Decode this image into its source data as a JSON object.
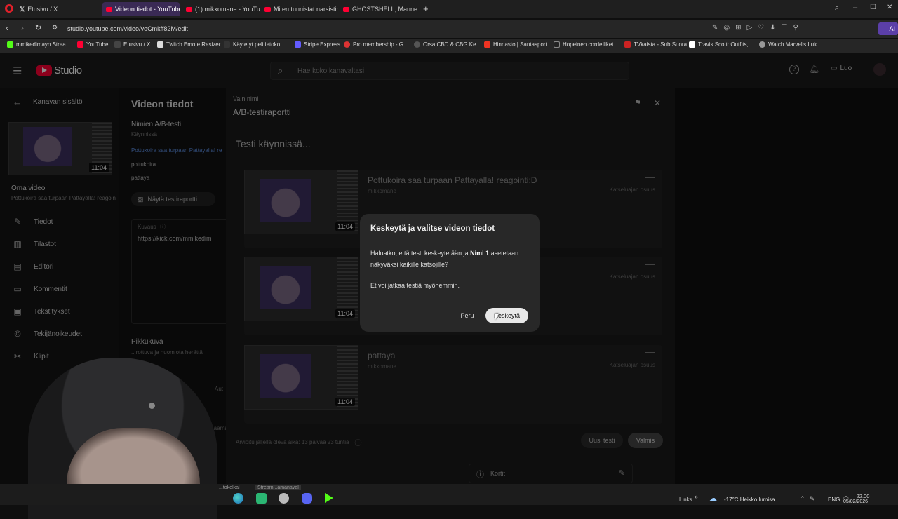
{
  "browser": {
    "tabs": [
      {
        "label": "Etusivu / X",
        "icon": "x-logo-icon"
      },
      {
        "label": "Videon tiedot - YouTube",
        "icon": "youtube-icon"
      },
      {
        "label": "(1) mikkomane - YouTube",
        "icon": "youtube-icon"
      },
      {
        "label": "Miten tunnistat narsistin?",
        "icon": "youtube-icon"
      },
      {
        "label": "GHOSTSHELL, Mannequin",
        "icon": "youtube-icon"
      }
    ],
    "url": "studio.youtube.com/video/voCmkff82M/edit",
    "bookmarks": [
      "mmikedimayn Strea...",
      "YouTube",
      "Etusivu / X",
      "Twitch Emote Resizer",
      "Käytetyt pelitietoko...",
      "Stripe Express",
      "Pro membership - G...",
      "Orsa CBD & CBG Ke...",
      "Hinnasto | Santasport",
      "Hopeinen cordelliket...",
      "TVkaista - Sub Suora",
      "Travis Scott: Outfits,...",
      "Watch Marvel's Luk..."
    ],
    "right_label": "AI"
  },
  "studio": {
    "logo_text": "Studio",
    "search_placeholder": "Hae koko kanavaltasi",
    "create_label": "Luo",
    "sidebar": {
      "back_label": "Kanavan sisältö",
      "thumb_duration": "11:04",
      "video_heading": "Oma video",
      "video_subtitle": "Pottukoira saa turpaan Pattayalla! reagointi:D",
      "items": [
        "Tiedot",
        "Tilastot",
        "Editori",
        "Kommentit",
        "Tekstitykset",
        "Tekijänoikeudet",
        "Klipit"
      ]
    },
    "details": {
      "heading": "Videon tiedot",
      "ab_title": "Nimien A/B-testi",
      "ab_status": "Käynnissä",
      "ab_items": [
        "Pottukoira saa turpaan Pattayalla! re",
        "pottukoira",
        "pattaya"
      ],
      "show_report_label": "Näytä testiraportti",
      "desc_label": "Kuvaus",
      "desc_value": "https://kick.com/mmikedim",
      "thumbnail_heading": "Pikkukuva",
      "thumbnail_sub": "...rottuva ja huomiota herättä",
      "auto_label": "Aut",
      "bottom_label": "...äämä"
    },
    "report": {
      "overline": "Vain nimi",
      "title": "A/B-testiraportti",
      "status": "Testi käynnissä...",
      "rows": [
        {
          "title": "Pottukoira saa turpaan Pattayalla! reagointi:D",
          "channel": "mikkomane",
          "metric": "Katseluajan osuus",
          "duration": "11:04"
        },
        {
          "title": "",
          "channel": "",
          "metric": "Katseluajan osuus",
          "duration": "11:04"
        },
        {
          "title": "pattaya",
          "channel": "mikkomane",
          "metric": "Katseluajan osuus",
          "duration": "11:04"
        }
      ],
      "footer_text": "Arvioitu jäljellä oleva aika: 13 päivää 23 tuntia",
      "new_test_label": "Uusi testi",
      "done_label": "Valmis"
    },
    "cards_label": "Kortit"
  },
  "dialog": {
    "title": "Keskeytä ja valitse videon tiedot",
    "body_prefix": "Haluatko, että testi keskeytetään ja ",
    "body_bold": "Nimi 1",
    "body_suffix": " asetetaan näkyväksi kaikille katsojille?",
    "body_2": "Et voi jatkaa testiä myöhemmin.",
    "cancel_label": "Peru",
    "confirm_label": "Keskeytä"
  },
  "taskbar": {
    "bottom_left_1": "...tokelkal",
    "bottom_left_2": "Stream ..amanaval",
    "links_label": "Links",
    "weather": "-17°C  Heikko lumisa...",
    "lang": "ENG",
    "time": "22.00",
    "date": "05/02/2026"
  }
}
